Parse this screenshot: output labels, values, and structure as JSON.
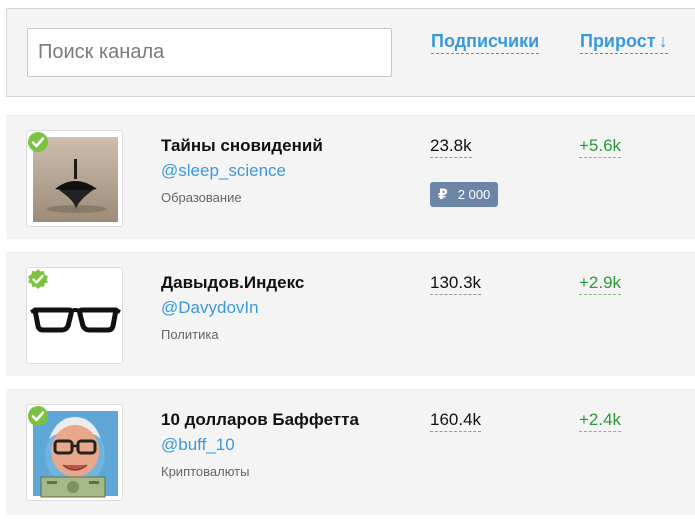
{
  "header": {
    "search_placeholder": "Поиск канала",
    "sort_subscribers": "Подписчики",
    "sort_growth": "Прирост",
    "sort_growth_arrow": "↓"
  },
  "channels": [
    {
      "title": "Тайны сновидений",
      "handle": "@sleep_science",
      "category": "Образование",
      "subscribers": "23.8k",
      "growth": "+5.6k",
      "price_currency": "₽",
      "price": "2 000",
      "avatar": "spinning-top",
      "verified": true
    },
    {
      "title": "Давыдов.Индекс",
      "handle": "@DavydovIn",
      "category": "Политика",
      "subscribers": "130.3k",
      "growth": "+2.9k",
      "avatar": "glasses",
      "verified": true
    },
    {
      "title": "10 долларов Баффетта",
      "handle": "@buff_10",
      "category": "Криптовалюты",
      "subscribers": "160.4k",
      "growth": "+2.4k",
      "avatar": "buffett-portrait",
      "verified": true
    }
  ],
  "colors": {
    "link": "#3a9ad9",
    "growth": "#2a9a3a",
    "verified": "#7cc142",
    "badge": "#6c86a8"
  }
}
